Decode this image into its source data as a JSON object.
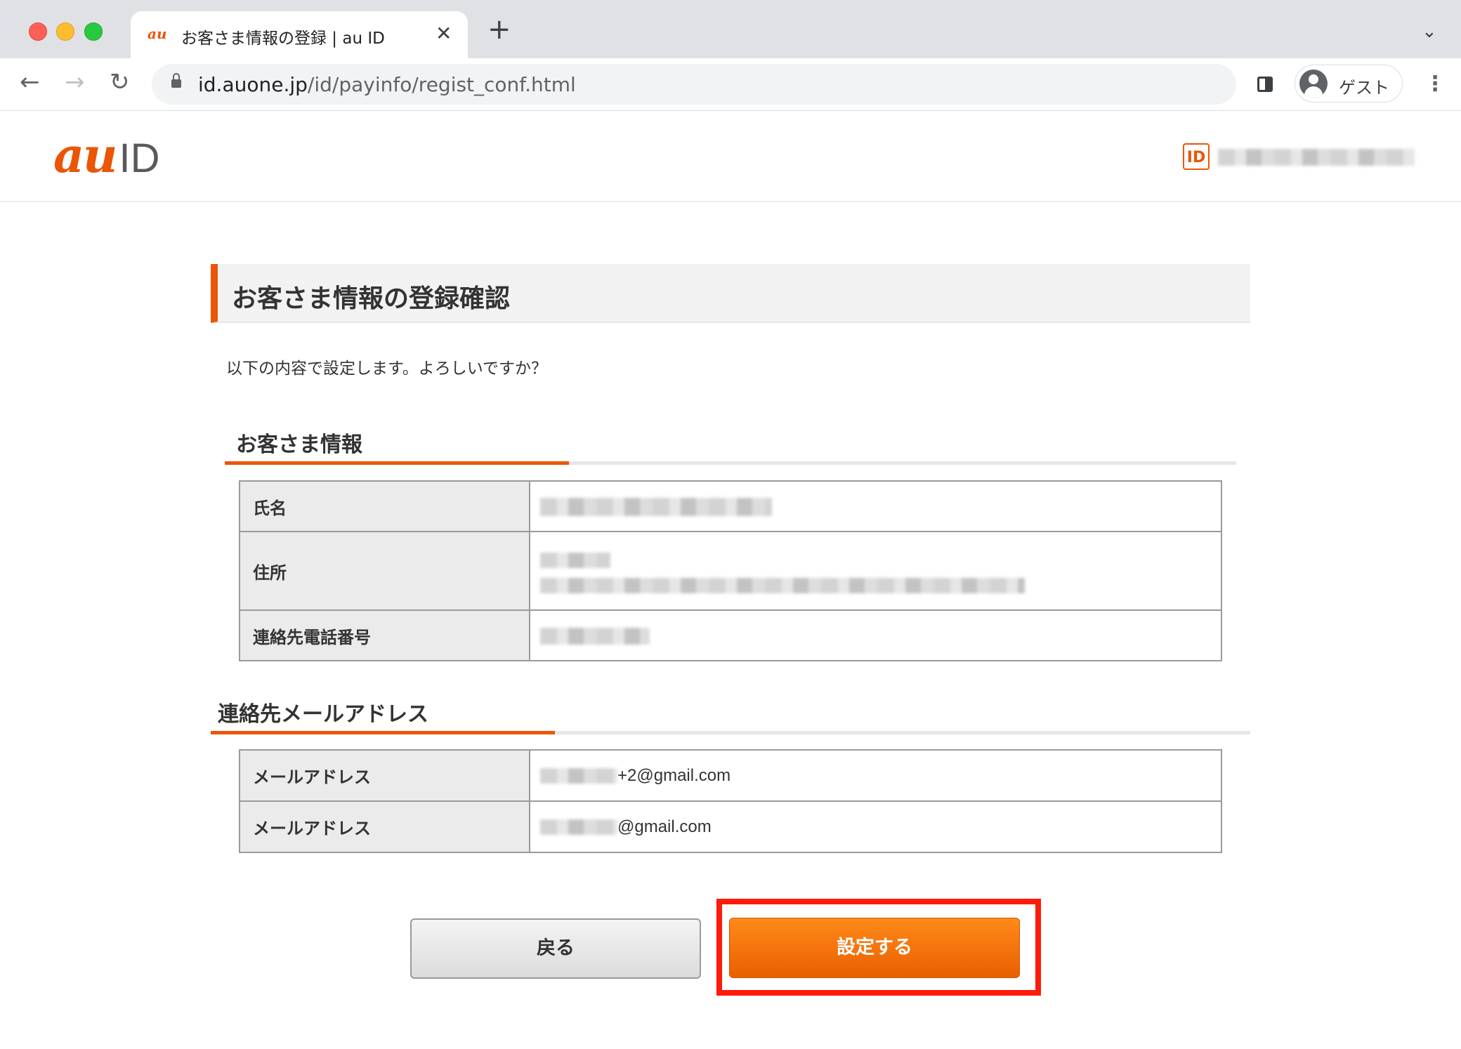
{
  "browser": {
    "tab_title": "お客さま情報の登録 | au ID",
    "tab_favicon_text": "au",
    "url_host": "id.auone.jp",
    "url_path": "/id/payinfo/regist_conf.html",
    "profile_label": "ゲスト",
    "icons": [
      "back-arrow-icon",
      "forward-arrow-icon",
      "reload-icon",
      "lock-icon",
      "side-panel-icon",
      "avatar-icon",
      "more-vert-icon",
      "close-icon",
      "plus-icon",
      "chevron-down-icon"
    ]
  },
  "header": {
    "logo_au": "au",
    "logo_id": "ID",
    "id_badge": "ID"
  },
  "page": {
    "heading": "お客さま情報の登録確認",
    "lead": "以下の内容で設定します。よろしいですか？"
  },
  "customer": {
    "title": "お客さま情報",
    "rows": [
      {
        "label": "氏名"
      },
      {
        "label": "住所"
      },
      {
        "label": "連絡先電話番号"
      }
    ]
  },
  "email": {
    "title": "連絡先メールアドレス",
    "rows": [
      {
        "label": "メールアドレス",
        "suffix": "+2@gmail.com"
      },
      {
        "label": "メールアドレス",
        "suffix": "@gmail.com"
      }
    ]
  },
  "buttons": {
    "back": "戻る",
    "submit": "設定する"
  },
  "colors": {
    "accent": "#eb5505",
    "highlight": "#ff1a0a"
  }
}
